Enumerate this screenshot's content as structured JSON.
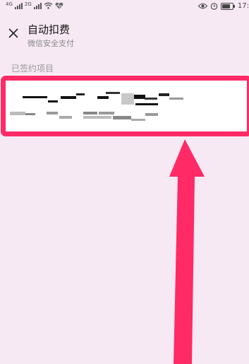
{
  "status_bar": {
    "network_1": "4G",
    "network_2": "2G",
    "time": "17:"
  },
  "header": {
    "title": "自动扣费",
    "subtitle": "微信安全支付"
  },
  "section": {
    "label": "已签约项目"
  },
  "icons": {
    "close": "close-icon",
    "wifi": "wifi-icon",
    "heart": "heart-rate-icon",
    "eye": "eye-icon",
    "alarm": "alarm-icon",
    "battery": "battery-icon",
    "arrow": "red-arrow-annotation"
  },
  "colors": {
    "background": "#f7e9f4",
    "highlight": "#ff2a66",
    "card": "#ffffff"
  }
}
